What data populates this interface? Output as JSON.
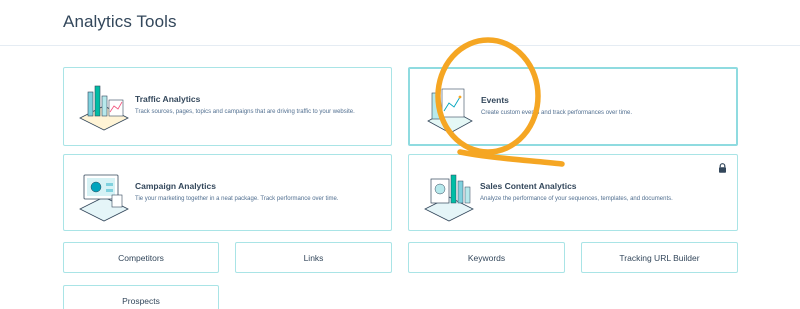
{
  "header": {
    "title": "Analytics Tools"
  },
  "cards": [
    {
      "title": "Traffic Analytics",
      "description": "Track sources, pages, topics and campaigns that are driving traffic to your website."
    },
    {
      "title": "Events",
      "description": "Create custom events and track performances over time."
    },
    {
      "title": "Campaign Analytics",
      "description": "Tie your marketing together in a neat package. Track performance over time."
    },
    {
      "title": "Sales Content Analytics",
      "description": "Analyze the performance of your sequences, templates, and documents."
    }
  ],
  "links": {
    "competitors": "Competitors",
    "links": "Links",
    "keywords": "Keywords",
    "tracking_url_builder": "Tracking URL Builder",
    "prospects": "Prospects"
  },
  "colors": {
    "border": "#a9e4e6",
    "text": "#33475b",
    "overlay": "#f5a623"
  }
}
